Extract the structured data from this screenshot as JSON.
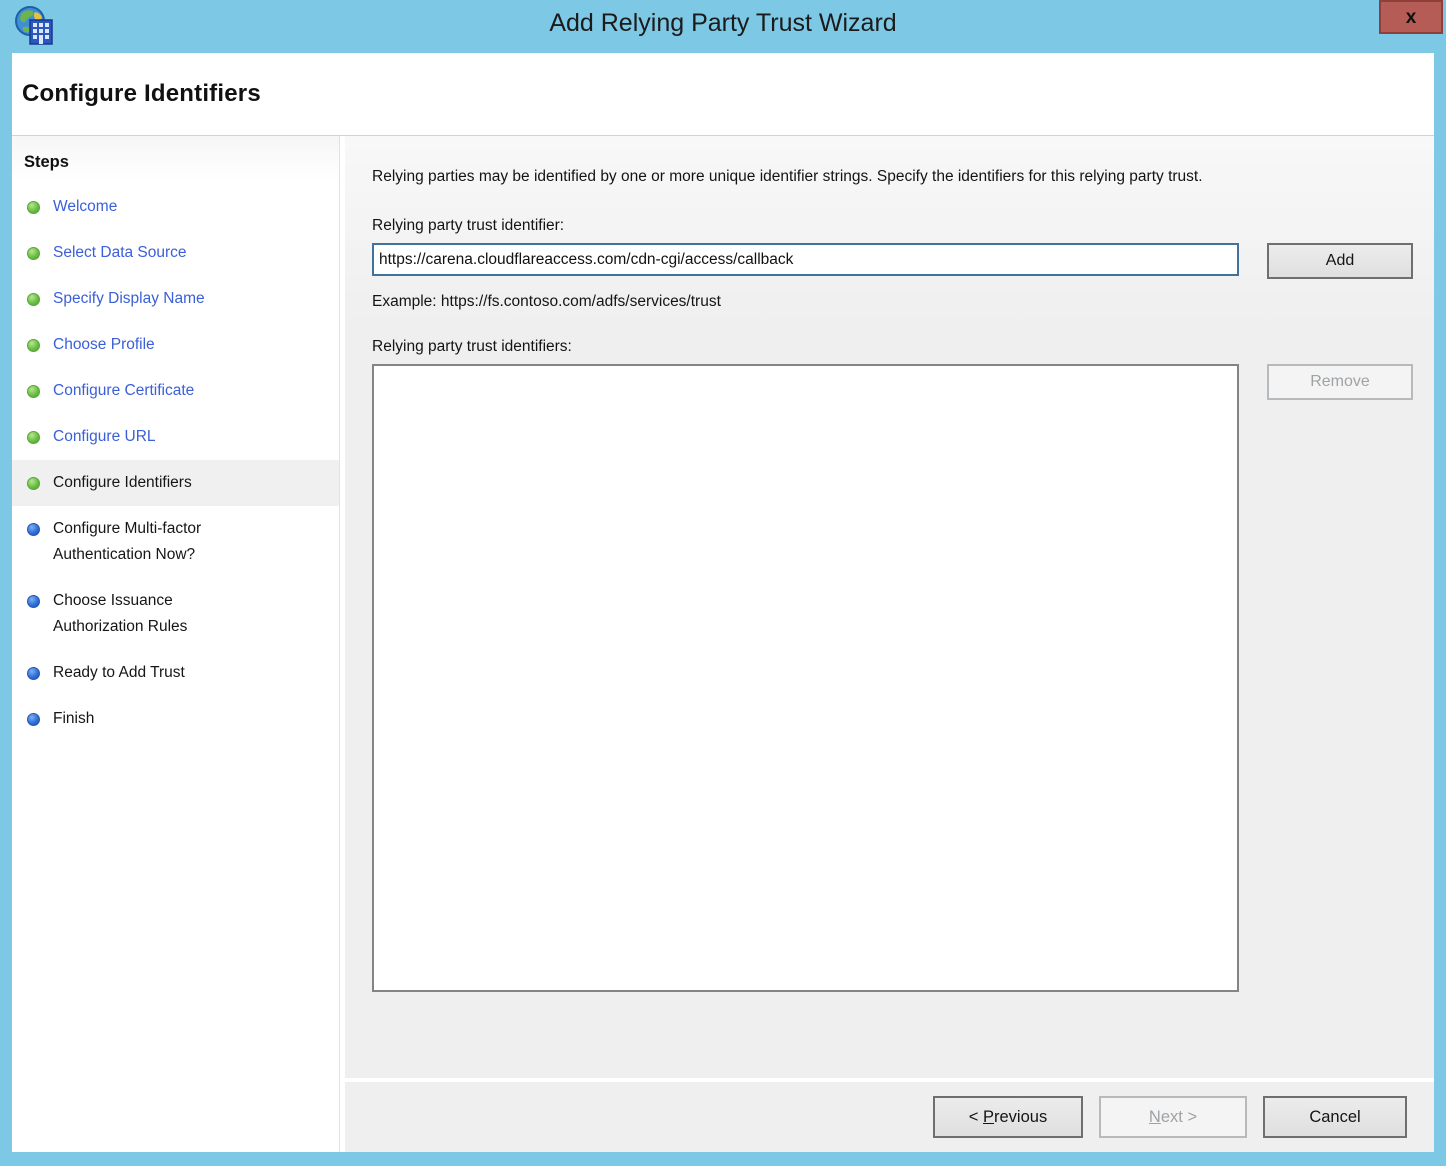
{
  "window": {
    "title": "Add Relying Party Trust Wizard",
    "close_label": "x"
  },
  "header": {
    "title": "Configure Identifiers"
  },
  "sidebar": {
    "heading": "Steps",
    "steps": [
      {
        "label": "Welcome",
        "state": "done"
      },
      {
        "label": "Select Data Source",
        "state": "done"
      },
      {
        "label": "Specify Display Name",
        "state": "done"
      },
      {
        "label": "Choose Profile",
        "state": "done"
      },
      {
        "label": "Configure Certificate",
        "state": "done"
      },
      {
        "label": "Configure URL",
        "state": "done"
      },
      {
        "label": "Configure Identifiers",
        "state": "current"
      },
      {
        "label": "Configure Multi-factor Authentication Now?",
        "state": "todo"
      },
      {
        "label": "Choose Issuance Authorization Rules",
        "state": "todo"
      },
      {
        "label": "Ready to Add Trust",
        "state": "todo"
      },
      {
        "label": "Finish",
        "state": "todo"
      }
    ]
  },
  "content": {
    "description": "Relying parties may be identified by one or more unique identifier strings. Specify the identifiers for this relying party trust.",
    "identifier_label": "Relying party trust identifier:",
    "identifier_value": "https://carena.cloudflareaccess.com/cdn-cgi/access/callback",
    "add_label": "Add",
    "example": "Example: https://fs.contoso.com/adfs/services/trust",
    "identifiers_label": "Relying party trust identifiers:",
    "identifiers_list": [],
    "remove_label": "Remove"
  },
  "footer": {
    "previous": {
      "pre": "< ",
      "key": "P",
      "rest": "revious"
    },
    "next": {
      "pre": "",
      "key": "N",
      "rest": "ext >"
    },
    "cancel_label": "Cancel"
  },
  "colors": {
    "titlebar_blue": "#7dc8e5",
    "close_button_red": "#b45c55",
    "link_blue": "#3a5fd9",
    "done_bullet_green": "#6abf45",
    "todo_bullet_blue": "#2e6fd8",
    "content_bg": "#efefef",
    "input_focus_border": "#41719c"
  }
}
